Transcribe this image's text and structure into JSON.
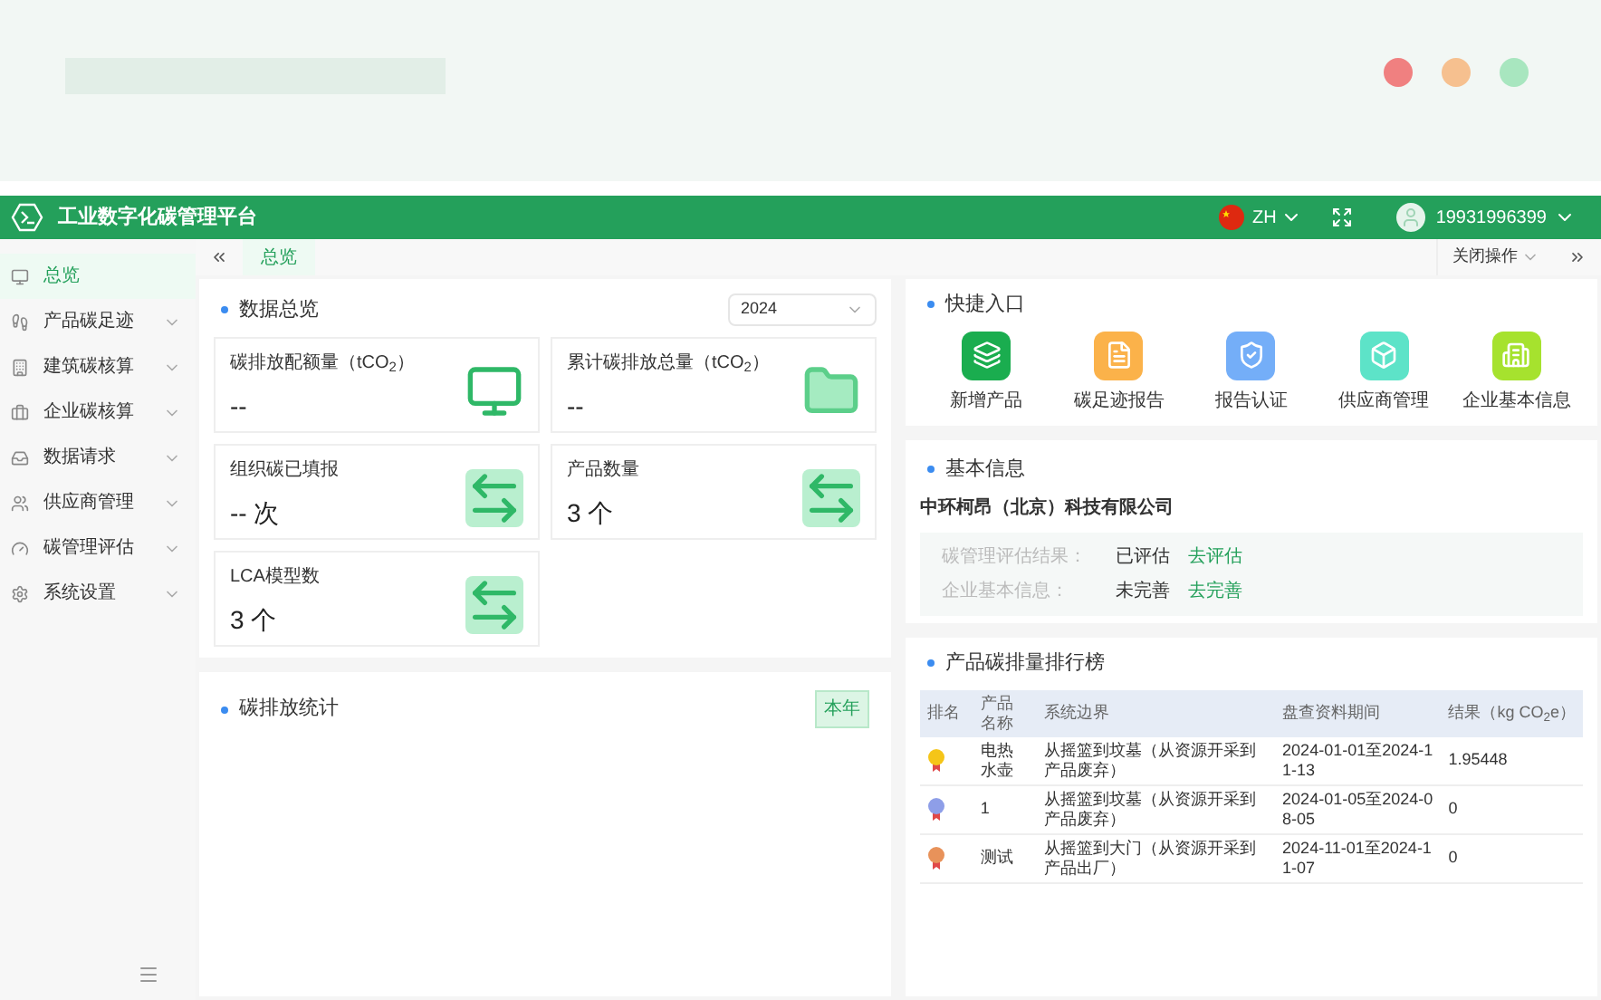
{
  "header": {
    "title": "工业数字化碳管理平台",
    "language": "ZH",
    "user": "19931996399"
  },
  "sidebar": {
    "items": [
      {
        "label": "总览",
        "selected": true,
        "expandable": false
      },
      {
        "label": "产品碳足迹",
        "selected": false,
        "expandable": true
      },
      {
        "label": "建筑碳核算",
        "selected": false,
        "expandable": true
      },
      {
        "label": "企业碳核算",
        "selected": false,
        "expandable": true
      },
      {
        "label": "数据请求",
        "selected": false,
        "expandable": true
      },
      {
        "label": "供应商管理",
        "selected": false,
        "expandable": true
      },
      {
        "label": "碳管理评估",
        "selected": false,
        "expandable": true
      },
      {
        "label": "系统设置",
        "selected": false,
        "expandable": true
      }
    ]
  },
  "tabs": [
    {
      "label": "总览",
      "selected": true
    }
  ],
  "tab_actions": {
    "label": "关闭操作"
  },
  "overview": {
    "title": "数据总览",
    "year": "2024",
    "stats": [
      {
        "label": "碳排放配额量（tCO$_{2}$）",
        "value": "--"
      },
      {
        "label": "累计碳排放总量（tCO$_{2}$）",
        "value": "--"
      },
      {
        "label": "组织碳已填报",
        "value": "-- 次"
      },
      {
        "label": "产品数量",
        "value": "3 个"
      },
      {
        "label": "LCA模型数",
        "value": "3 个"
      }
    ]
  },
  "emissions": {
    "title": "碳排放统计",
    "button": {
      "label": "本年",
      "selected": true
    }
  },
  "quick_entry": {
    "title": "快捷入口",
    "items": [
      {
        "label": "新增产品",
        "color": "#1aad4f"
      },
      {
        "label": "碳足迹报告",
        "color": "#fbb24a"
      },
      {
        "label": "报告认证",
        "color": "#74aef8"
      },
      {
        "label": "供应商管理",
        "color": "#5de3c8"
      },
      {
        "label": "企业基本信息",
        "color": "#a6e22e"
      }
    ]
  },
  "basic_info": {
    "title": "基本信息",
    "company": "中环柯昂（北京）科技有限公司",
    "rows": [
      {
        "label": "碳管理评估结果：",
        "value": "已评估",
        "link": "去评估"
      },
      {
        "label": "企业基本信息：",
        "value": "未完善",
        "link": "去完善"
      }
    ]
  },
  "ranking": {
    "title": "产品碳排量排行榜",
    "columns": [
      "排名",
      "产品名称",
      "系统边界",
      "盘查资料期间",
      "结果（kg CO$_{2}$e）"
    ],
    "rows": [
      {
        "color": "#f5c518",
        "name": "电热水壶",
        "boundary": "从摇篮到坟墓（从资源开采到产品废弃）",
        "period": "2024-01-01至2024-11-13",
        "result": "1.95448"
      },
      {
        "color": "#8e9ee8",
        "name": "1",
        "boundary": "从摇篮到坟墓（从资源开采到产品废弃）",
        "period": "2024-01-05至2024-08-05",
        "result": "0"
      },
      {
        "color": "#e8925a",
        "name": "测试",
        "boundary": "从摇篮到大门（从资源开采到产品出厂）",
        "period": "2024-11-01至2024-11-07",
        "result": "0"
      }
    ]
  }
}
